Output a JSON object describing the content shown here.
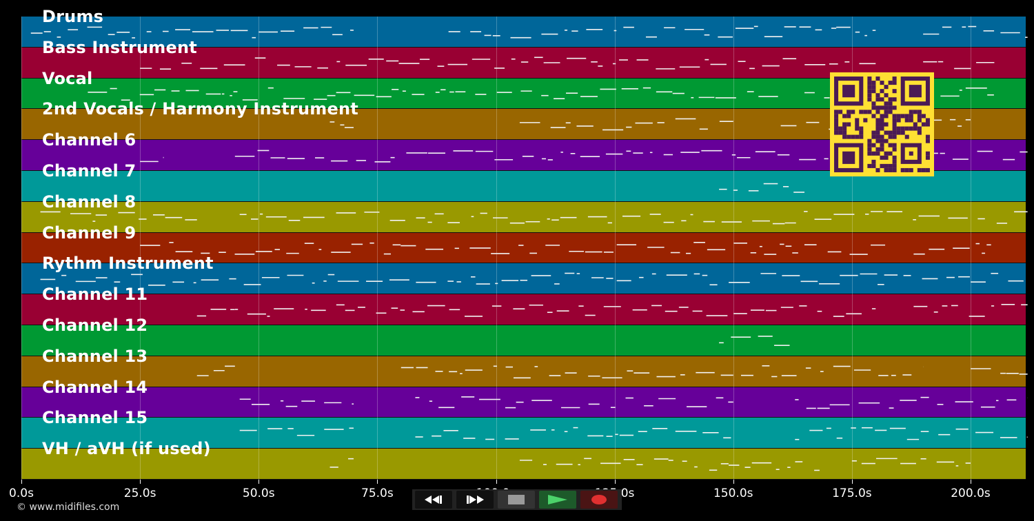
{
  "tracks": [
    {
      "label": "Drums",
      "color": "#006699"
    },
    {
      "label": "Bass Instrument",
      "color": "#990033"
    },
    {
      "label": "Vocal",
      "color": "#009933"
    },
    {
      "label": "2nd Vocals / Harmony Instrument",
      "color": "#996600"
    },
    {
      "label": "Channel 6",
      "color": "#660099"
    },
    {
      "label": "Channel 7",
      "color": "#009999"
    },
    {
      "label": "Channel 8",
      "color": "#999900"
    },
    {
      "label": "Channel 9",
      "color": "#992200"
    },
    {
      "label": "Rythm Instrument",
      "color": "#006699"
    },
    {
      "label": "Channel 11",
      "color": "#990033"
    },
    {
      "label": "Channel 12",
      "color": "#009933"
    },
    {
      "label": "Channel 13",
      "color": "#996600"
    },
    {
      "label": "Channel 14",
      "color": "#660099"
    },
    {
      "label": "Channel 15",
      "color": "#009999"
    },
    {
      "label": "VH / aVH (if used)",
      "color": "#999900"
    }
  ],
  "timeline": {
    "ticks": [
      "0.0s",
      "25.0s",
      "50.0s",
      "75.0s",
      "100.0s",
      "125.0s",
      "150.0s",
      "175.0s",
      "200.0s"
    ]
  },
  "copyright": "© www.midifiles.com",
  "transport": {
    "rewind_icon": "rewind-icon",
    "fast_forward_icon": "fast-forward-icon",
    "stop_icon": "stop-icon",
    "play_icon": "play-icon",
    "record_icon": "record-icon"
  },
  "qr_icon": "qr-code-icon"
}
